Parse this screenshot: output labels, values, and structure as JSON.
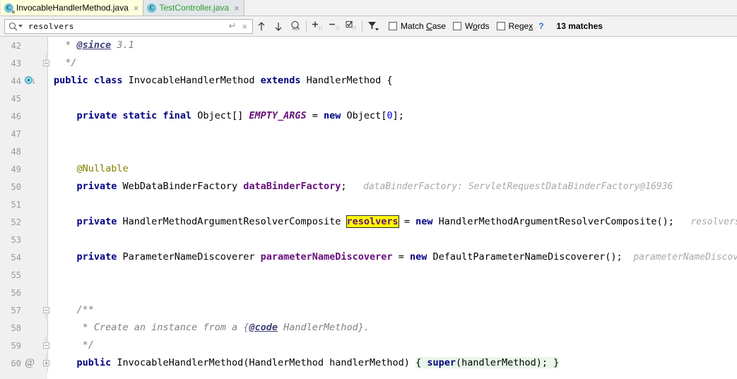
{
  "window": {
    "app": "IntelliJ IDEA Editor"
  },
  "tabs": [
    {
      "label": "InvocableHandlerMethod.java",
      "icon": "java-class-icon",
      "close": "×",
      "active": true,
      "letter": "C"
    },
    {
      "label": "TestController.java",
      "icon": "java-class-icon",
      "close": "×",
      "active": false,
      "letter": "C"
    }
  ],
  "find_toolbar": {
    "search_value": "resolvers",
    "search_placeholder": "Search",
    "enter_label": "↵",
    "clear_label": "×",
    "prev_title": "Previous Occurrence",
    "next_title": "Next Occurrence",
    "select_all_title": "Select All Occurrences",
    "add_line_title": "Add Line",
    "remove_line_title": "Remove Line",
    "toggle_line_title": "Toggle Line",
    "filter_title": "Filter Search Results",
    "checkboxes": [
      {
        "label_pre": "Match ",
        "label_underline": "C",
        "label_post": "ase",
        "checked": false,
        "name": "match-case"
      },
      {
        "label_pre": "W",
        "label_underline": "o",
        "label_post": "rds",
        "checked": false,
        "name": "words"
      },
      {
        "label_pre": "Rege",
        "label_underline": "x",
        "label_post": "",
        "checked": false,
        "name": "regex"
      }
    ],
    "help": "?",
    "matches": "13 matches"
  },
  "editor": {
    "lines": [
      {
        "no": "42",
        "fold": "none",
        "ann": "none",
        "segments": [
          {
            "text": "  * ",
            "cls": "doc"
          },
          {
            "text": "@since",
            "cls": "doctag"
          },
          {
            "text": " 3.1",
            "cls": "doc"
          }
        ]
      },
      {
        "no": "43",
        "fold": "end",
        "ann": "none",
        "segments": [
          {
            "text": "  */",
            "cls": "doc"
          }
        ]
      },
      {
        "no": "44",
        "fold": "none",
        "ann": "overridden",
        "segments": [
          {
            "text": "public class ",
            "cls": "kw"
          },
          {
            "text": "InvocableHandlerMethod ",
            "cls": ""
          },
          {
            "text": "extends ",
            "cls": "kw"
          },
          {
            "text": "HandlerMethod {",
            "cls": ""
          }
        ]
      },
      {
        "no": "45",
        "fold": "none",
        "ann": "none",
        "segments": []
      },
      {
        "no": "46",
        "fold": "none",
        "ann": "none",
        "segments": [
          {
            "text": "    ",
            "cls": ""
          },
          {
            "text": "private static final ",
            "cls": "kw"
          },
          {
            "text": "Object[] ",
            "cls": ""
          },
          {
            "text": "EMPTY_ARGS",
            "cls": "fld"
          },
          {
            "text": " = ",
            "cls": ""
          },
          {
            "text": "new ",
            "cls": "kw"
          },
          {
            "text": "Object[",
            "cls": ""
          },
          {
            "text": "0",
            "cls": "num"
          },
          {
            "text": "];",
            "cls": ""
          }
        ]
      },
      {
        "no": "47",
        "fold": "none",
        "ann": "none",
        "segments": []
      },
      {
        "no": "48",
        "fold": "none",
        "ann": "none",
        "segments": []
      },
      {
        "no": "49",
        "fold": "none",
        "ann": "none",
        "segments": [
          {
            "text": "    ",
            "cls": ""
          },
          {
            "text": "@Nullable",
            "cls": "anno"
          }
        ]
      },
      {
        "no": "50",
        "fold": "none",
        "ann": "none",
        "segments": [
          {
            "text": "    ",
            "cls": ""
          },
          {
            "text": "private ",
            "cls": "kw"
          },
          {
            "text": "WebDataBinderFactory ",
            "cls": ""
          },
          {
            "text": "dataBinderFactory",
            "cls": "fldn"
          },
          {
            "text": ";",
            "cls": ""
          },
          {
            "text": "   dataBinderFactory: ServletRequestDataBinderFactory@16936",
            "cls": "hint"
          }
        ]
      },
      {
        "no": "51",
        "fold": "none",
        "ann": "none",
        "segments": []
      },
      {
        "no": "52",
        "fold": "none",
        "ann": "none",
        "segments": [
          {
            "text": "    ",
            "cls": ""
          },
          {
            "text": "private ",
            "cls": "kw"
          },
          {
            "text": "HandlerMethodArgumentResolverComposite ",
            "cls": ""
          },
          {
            "text": "resolvers",
            "cls": "hl"
          },
          {
            "text": " = ",
            "cls": ""
          },
          {
            "text": "new ",
            "cls": "kw"
          },
          {
            "text": "HandlerMethodArgumentResolverComposite();",
            "cls": ""
          },
          {
            "text": "   resolvers:",
            "cls": "hint"
          }
        ]
      },
      {
        "no": "53",
        "fold": "none",
        "ann": "none",
        "segments": []
      },
      {
        "no": "54",
        "fold": "none",
        "ann": "none",
        "segments": [
          {
            "text": "    ",
            "cls": ""
          },
          {
            "text": "private ",
            "cls": "kw"
          },
          {
            "text": "ParameterNameDiscoverer ",
            "cls": ""
          },
          {
            "text": "parameterNameDiscoverer",
            "cls": "fldn"
          },
          {
            "text": " = ",
            "cls": ""
          },
          {
            "text": "new ",
            "cls": "kw"
          },
          {
            "text": "DefaultParameterNameDiscoverer();",
            "cls": ""
          },
          {
            "text": "  parameterNameDiscove",
            "cls": "hint"
          }
        ]
      },
      {
        "no": "55",
        "fold": "none",
        "ann": "none",
        "segments": []
      },
      {
        "no": "56",
        "fold": "none",
        "ann": "none",
        "segments": []
      },
      {
        "no": "57",
        "fold": "start",
        "ann": "none",
        "segments": [
          {
            "text": "    /**",
            "cls": "doc"
          }
        ]
      },
      {
        "no": "58",
        "fold": "none",
        "ann": "none",
        "segments": [
          {
            "text": "     * Create an instance from a ",
            "cls": "doc"
          },
          {
            "text": "{",
            "cls": "doc"
          },
          {
            "text": "@code",
            "cls": "doctag"
          },
          {
            "text": " HandlerMethod}.",
            "cls": "doc"
          }
        ]
      },
      {
        "no": "59",
        "fold": "end",
        "ann": "none",
        "segments": [
          {
            "text": "     */",
            "cls": "doc"
          }
        ]
      },
      {
        "no": "60",
        "fold": "plus",
        "ann": "at",
        "segments": [
          {
            "text": "    ",
            "cls": ""
          },
          {
            "text": "public ",
            "cls": "kw"
          },
          {
            "text": "InvocableHandlerMethod(HandlerMethod handlerMethod) ",
            "cls": ""
          },
          {
            "text": "{ ",
            "cls": "fold-bg"
          },
          {
            "text": "super",
            "cls": "kw fold-bg"
          },
          {
            "text": "(handlerMethod); }",
            "cls": "fold-bg"
          }
        ]
      }
    ]
  },
  "colors": {
    "highlight": "#ffff00",
    "keyword": "#000080",
    "field": "#660e7a",
    "comment": "#808080",
    "hint": "#a8a8a8",
    "fold_bg": "#e9f5e9",
    "tab_active_bg": "#ffffdd",
    "vcs_green": "#2e9b2e"
  }
}
